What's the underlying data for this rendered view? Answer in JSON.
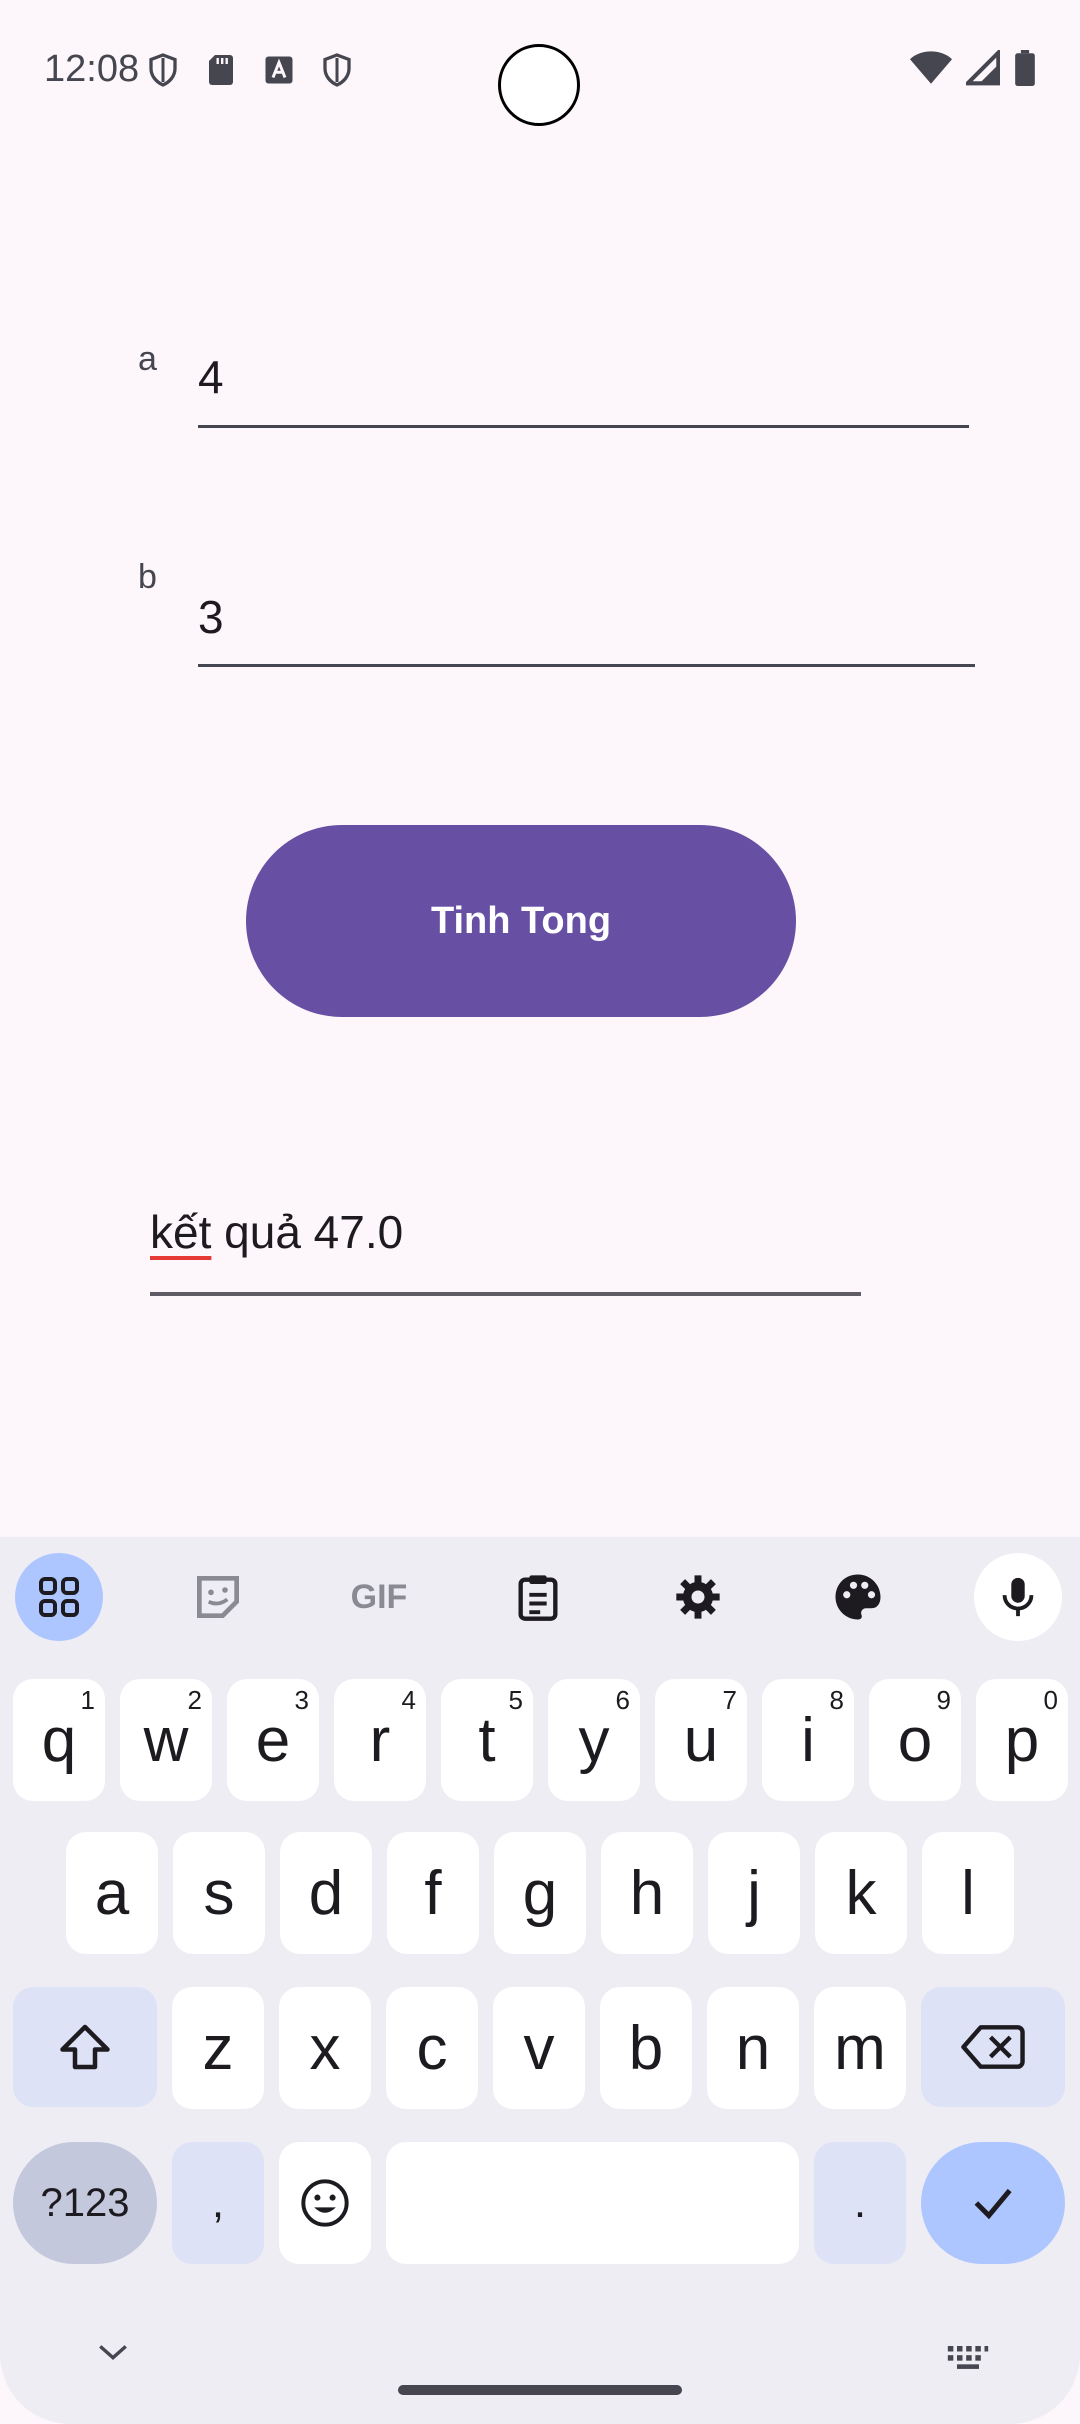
{
  "status_bar": {
    "time": "12:08"
  },
  "form": {
    "field_a": {
      "label": "a",
      "value": "4"
    },
    "field_b": {
      "label": "b",
      "value": "3"
    },
    "button_label": "Tinh Tong",
    "result": {
      "misspelled_word": "kết",
      "rest": " quả 47.0"
    }
  },
  "keyboard": {
    "toolbar": [
      "apps-grid-icon",
      "sticker-icon",
      "gif-icon",
      "clipboard-icon",
      "settings-icon",
      "palette-icon",
      "microphone-icon"
    ],
    "gif_label": "GIF",
    "row1": [
      {
        "k": "q",
        "h": "1"
      },
      {
        "k": "w",
        "h": "2"
      },
      {
        "k": "e",
        "h": "3"
      },
      {
        "k": "r",
        "h": "4"
      },
      {
        "k": "t",
        "h": "5"
      },
      {
        "k": "y",
        "h": "6"
      },
      {
        "k": "u",
        "h": "7"
      },
      {
        "k": "i",
        "h": "8"
      },
      {
        "k": "o",
        "h": "9"
      },
      {
        "k": "p",
        "h": "0"
      }
    ],
    "row2": [
      "a",
      "s",
      "d",
      "f",
      "g",
      "h",
      "j",
      "k",
      "l"
    ],
    "row3": [
      "z",
      "x",
      "c",
      "v",
      "b",
      "n",
      "m"
    ],
    "sym_label": "?123",
    "comma": ",",
    "period": "."
  },
  "colors": {
    "accent": "#6750a4",
    "background": "#fdf6fb",
    "keyboard_bg": "#eeedf4",
    "enter_key": "#aec6ff"
  }
}
